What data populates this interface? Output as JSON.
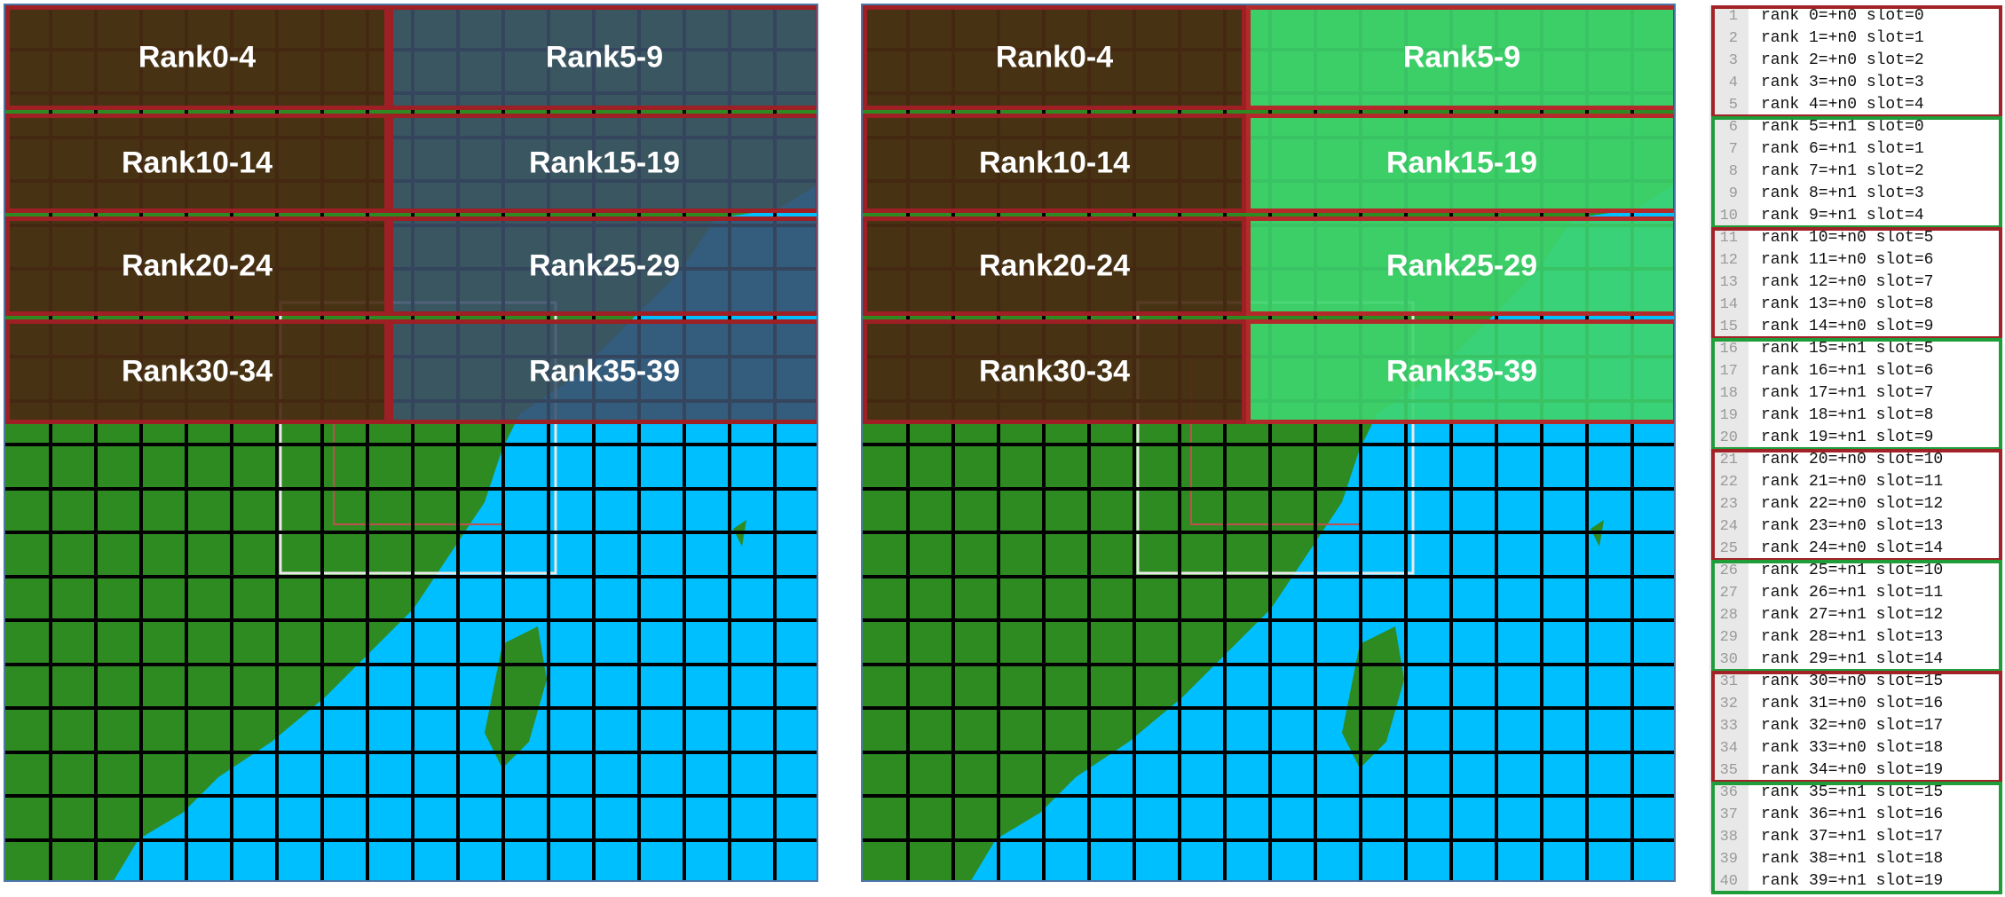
{
  "colors": {
    "land": "#2e8b22",
    "sea": "#00bfff",
    "grid": "#000000",
    "node0_overlay": "#4a2b13",
    "node1_overlay": "#3ed46e",
    "node0_border": "#9e1f24",
    "node1_border": "#1f9d3a",
    "overlay_blue": "#3b4f6a"
  },
  "left_panel": {
    "labels": [
      "Rank0-4",
      "Rank5-9",
      "Rank10-14",
      "Rank15-19",
      "Rank20-24",
      "Rank25-29",
      "Rank30-34",
      "Rank35-39"
    ]
  },
  "right_panel": {
    "labels": [
      "Rank0-4",
      "Rank5-9",
      "Rank10-14",
      "Rank15-19",
      "Rank20-24",
      "Rank25-29",
      "Rank30-34",
      "Rank35-39"
    ]
  },
  "listing": {
    "lines": [
      {
        "n": "1",
        "text": "rank 0=+n0 slot=0"
      },
      {
        "n": "2",
        "text": "rank 1=+n0 slot=1"
      },
      {
        "n": "3",
        "text": "rank 2=+n0 slot=2"
      },
      {
        "n": "4",
        "text": "rank 3=+n0 slot=3"
      },
      {
        "n": "5",
        "text": "rank 4=+n0 slot=4"
      },
      {
        "n": "6",
        "text": "rank 5=+n1 slot=0"
      },
      {
        "n": "7",
        "text": "rank 6=+n1 slot=1"
      },
      {
        "n": "8",
        "text": "rank 7=+n1 slot=2"
      },
      {
        "n": "9",
        "text": "rank 8=+n1 slot=3"
      },
      {
        "n": "10",
        "text": "rank 9=+n1 slot=4"
      },
      {
        "n": "11",
        "text": "rank 10=+n0 slot=5"
      },
      {
        "n": "12",
        "text": "rank 11=+n0 slot=6"
      },
      {
        "n": "13",
        "text": "rank 12=+n0 slot=7"
      },
      {
        "n": "14",
        "text": "rank 13=+n0 slot=8"
      },
      {
        "n": "15",
        "text": "rank 14=+n0 slot=9"
      },
      {
        "n": "16",
        "text": "rank 15=+n1 slot=5"
      },
      {
        "n": "17",
        "text": "rank 16=+n1 slot=6"
      },
      {
        "n": "18",
        "text": "rank 17=+n1 slot=7"
      },
      {
        "n": "19",
        "text": "rank 18=+n1 slot=8"
      },
      {
        "n": "20",
        "text": "rank 19=+n1 slot=9"
      },
      {
        "n": "21",
        "text": "rank 20=+n0 slot=10"
      },
      {
        "n": "22",
        "text": "rank 21=+n0 slot=11"
      },
      {
        "n": "23",
        "text": "rank 22=+n0 slot=12"
      },
      {
        "n": "24",
        "text": "rank 23=+n0 slot=13"
      },
      {
        "n": "25",
        "text": "rank 24=+n0 slot=14"
      },
      {
        "n": "26",
        "text": "rank 25=+n1 slot=10"
      },
      {
        "n": "27",
        "text": "rank 26=+n1 slot=11"
      },
      {
        "n": "28",
        "text": "rank 27=+n1 slot=12"
      },
      {
        "n": "29",
        "text": "rank 28=+n1 slot=13"
      },
      {
        "n": "30",
        "text": "rank 29=+n1 slot=14"
      },
      {
        "n": "31",
        "text": "rank 30=+n0 slot=15"
      },
      {
        "n": "32",
        "text": "rank 31=+n0 slot=16"
      },
      {
        "n": "33",
        "text": "rank 32=+n0 slot=17"
      },
      {
        "n": "34",
        "text": "rank 33=+n0 slot=18"
      },
      {
        "n": "35",
        "text": "rank 34=+n0 slot=19"
      },
      {
        "n": "36",
        "text": "rank 35=+n1 slot=15"
      },
      {
        "n": "37",
        "text": "rank 36=+n1 slot=16"
      },
      {
        "n": "38",
        "text": "rank 37=+n1 slot=17"
      },
      {
        "n": "39",
        "text": "rank 38=+n1 slot=18"
      },
      {
        "n": "40",
        "text": "rank 39=+n1 slot=19"
      }
    ]
  }
}
